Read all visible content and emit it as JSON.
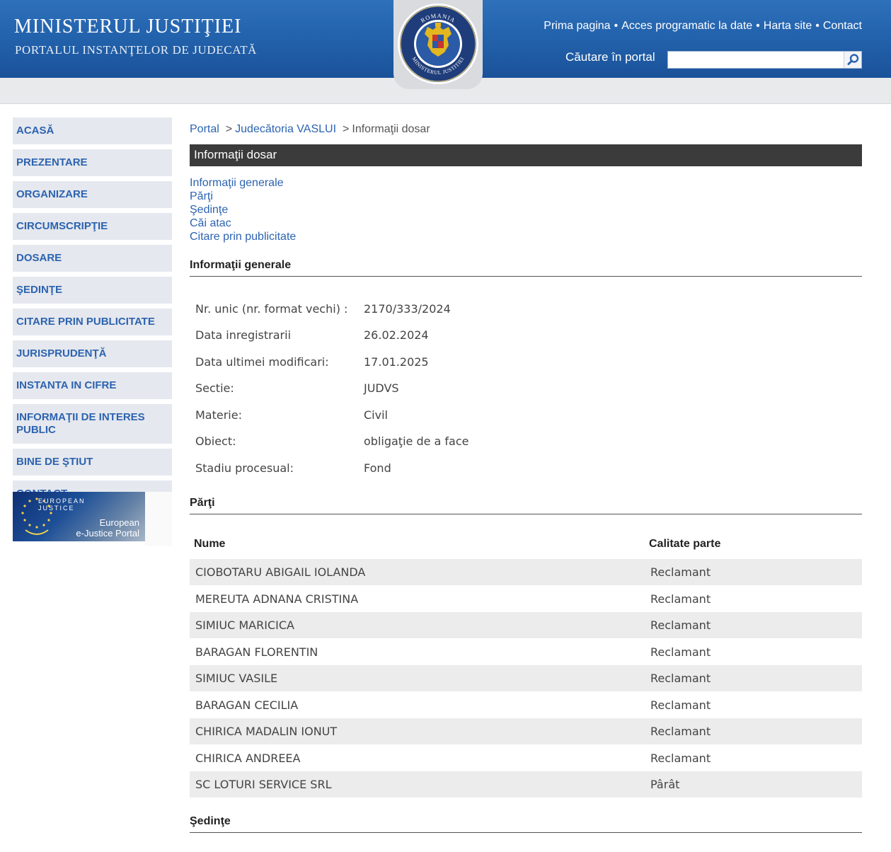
{
  "header": {
    "title": "MINISTERUL JUSTIŢIEI",
    "subtitle": "PORTALUL INSTANŢELOR DE JUDECATĂ",
    "emblem_top_text": "ROMANIA",
    "emblem_bottom_text": "MINISTERUL JUSTITIEI",
    "nav": [
      "Prima pagina",
      "Acces programatic la date",
      "Harta site",
      "Contact"
    ],
    "nav_separator": "•",
    "search_label": "Căutare în portal",
    "search_value": "",
    "search_icon": "magnifier-icon"
  },
  "sidebar": {
    "items": [
      "ACASĂ",
      "PREZENTARE",
      "ORGANIZARE",
      "CIRCUMSCRIPŢIE",
      "DOSARE",
      "ŞEDINŢE",
      "CITARE PRIN PUBLICITATE",
      "JURISPRUDENŢĂ",
      "INSTANTA IN CIFRE",
      "INFORMAŢII DE INTERES PUBLIC",
      "BINE DE ŞTIUT",
      "CONTACT"
    ],
    "banner": {
      "top": "EUROPEAN JUSTICE",
      "bottom_line1": "European",
      "bottom_line2": "e-Justice Portal"
    }
  },
  "breadcrumb": {
    "items": [
      "Portal",
      "Judecătoria VASLUI"
    ],
    "current": "Informaţii dosar",
    "separator": ">"
  },
  "page_title": "Informaţii dosar",
  "anchors": [
    "Informaţii generale",
    "Părţi",
    "Şedinţe",
    "Căi atac",
    "Citare prin publicitate"
  ],
  "general": {
    "title": "Informaţii generale",
    "rows": [
      {
        "label": "Nr. unic (nr. format vechi) :",
        "value": "2170/333/2024"
      },
      {
        "label": "Data inregistrarii",
        "value": "26.02.2024"
      },
      {
        "label": "Data ultimei modificari:",
        "value": "17.01.2025"
      },
      {
        "label": "Sectie:",
        "value": "JUDVS"
      },
      {
        "label": "Materie:",
        "value": "Civil"
      },
      {
        "label": "Obiect:",
        "value": "obligaţie de a face"
      },
      {
        "label": "Stadiu procesual:",
        "value": "Fond"
      }
    ]
  },
  "parti": {
    "title": "Părţi",
    "columns": [
      "Nume",
      "Calitate parte"
    ],
    "rows": [
      {
        "nume": "CIOBOTARU ABIGAIL IOLANDA",
        "calitate": "Reclamant"
      },
      {
        "nume": "MEREUTA ADNANA CRISTINA",
        "calitate": "Reclamant"
      },
      {
        "nume": "SIMIUC MARICICA",
        "calitate": "Reclamant"
      },
      {
        "nume": "BARAGAN FLORENTIN",
        "calitate": "Reclamant"
      },
      {
        "nume": "SIMIUC VASILE",
        "calitate": "Reclamant"
      },
      {
        "nume": "BARAGAN CECILIA",
        "calitate": "Reclamant"
      },
      {
        "nume": "CHIRICA MADALIN IONUT",
        "calitate": "Reclamant"
      },
      {
        "nume": "CHIRICA ANDREEA",
        "calitate": "Reclamant"
      },
      {
        "nume": "SC LOTURI SERVICE SRL",
        "calitate": "Pârât"
      }
    ]
  },
  "sedinte": {
    "title": "Şedinţe"
  },
  "colors": {
    "header_blue": "#2363ad",
    "link_blue": "#2c63b0",
    "sidebar_bg": "#e5e8ee",
    "section_bar": "#3b3b3b",
    "row_alt": "#ececec"
  }
}
